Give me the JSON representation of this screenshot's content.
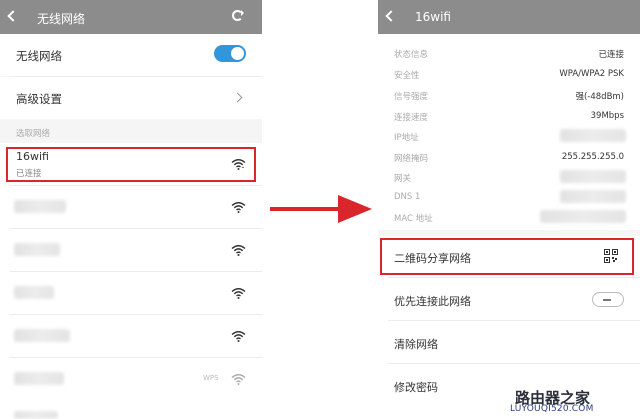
{
  "left": {
    "header_title": "无线网络",
    "wlan_label": "无线网络",
    "wlan_enabled": true,
    "advanced_label": "高级设置",
    "choose_network_label": "选取网络",
    "connected_network": {
      "ssid": "16wifi",
      "status": "已连接"
    },
    "wps_label": "WPS"
  },
  "right": {
    "header_title": "16wifi",
    "info": {
      "status_label": "状态信息",
      "status_value": "已连接",
      "security_label": "安全性",
      "security_value": "WPA/WPA2 PSK",
      "signal_label": "信号强度",
      "signal_value": "强(-48dBm)",
      "speed_label": "连接速度",
      "speed_value": "39Mbps",
      "ip_label": "IP地址",
      "mask_label": "网络掩码",
      "mask_value": "255.255.255.0",
      "gateway_label": "网关",
      "dns_label": "DNS 1",
      "mac_label": "MAC 地址"
    },
    "qr_share_label": "二维码分享网络",
    "priority_label": "优先连接此网络",
    "priority_enabled": false,
    "forget_label": "清除网络",
    "modify_password_label": "修改密码"
  },
  "watermark": {
    "main": "路由器之家",
    "sub": "LUYOUQI520.COM"
  },
  "colors": {
    "header_bg": "#8c8c8c",
    "toggle_on": "#3296dc",
    "highlight_red": "#d9262a"
  }
}
